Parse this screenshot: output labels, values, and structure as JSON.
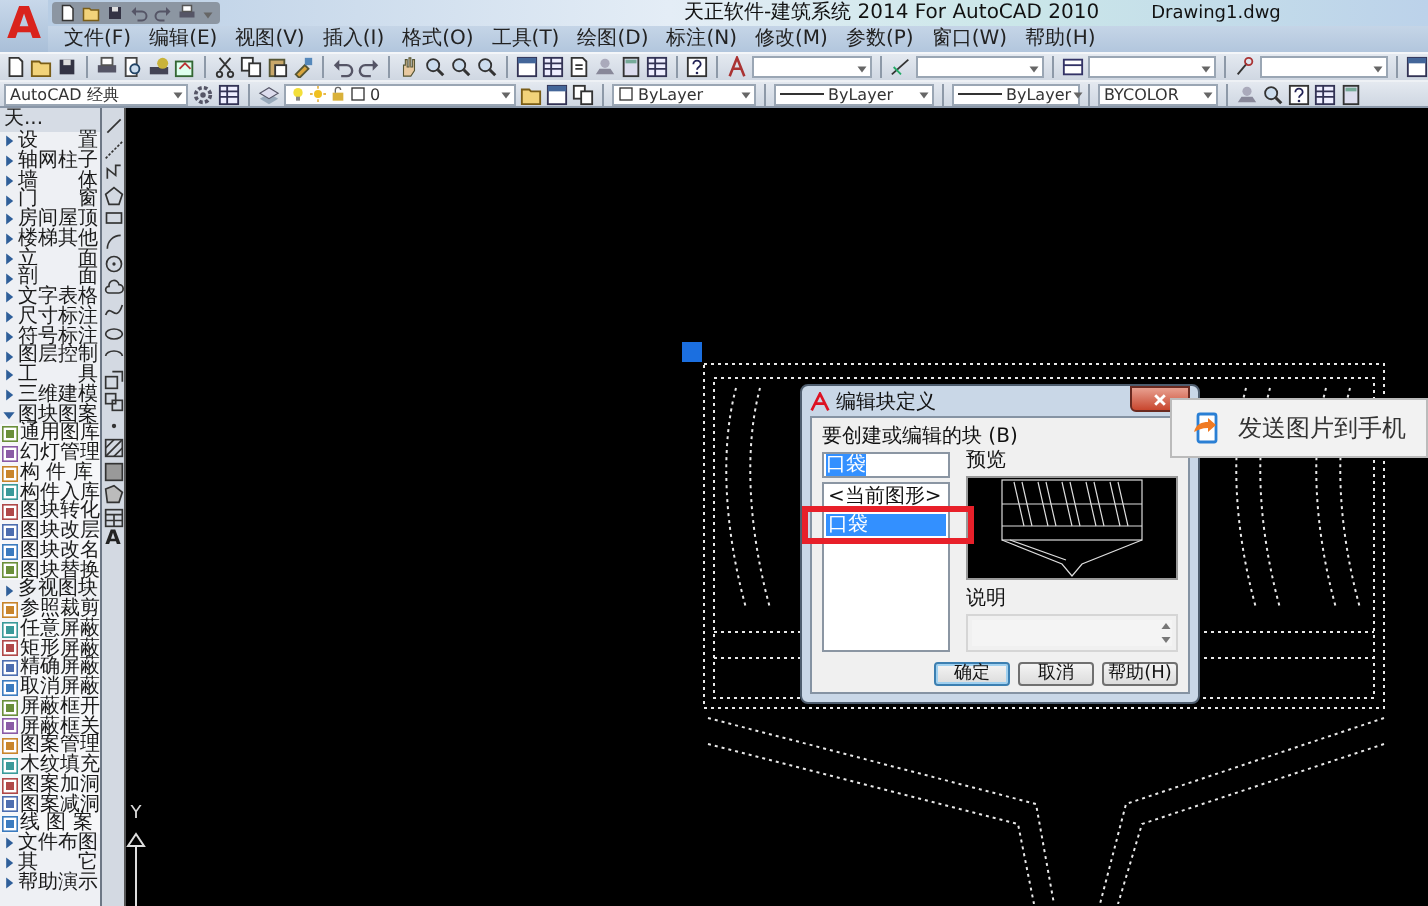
{
  "app_logo": {
    "letter": "A"
  },
  "title_bar": {
    "title": "天正软件-建筑系统 2014  For AutoCAD 2010",
    "document": "Drawing1.dwg"
  },
  "menu": [
    "文件(F)",
    "编辑(E)",
    "视图(V)",
    "插入(I)",
    "格式(O)",
    "工具(T)",
    "绘图(D)",
    "标注(N)",
    "修改(M)",
    "参数(P)",
    "窗口(W)",
    "帮助(H)"
  ],
  "properties_bar": {
    "workspace": "AutoCAD 经典",
    "layer": "0",
    "color_setting": "ByLayer",
    "linetype": "ByLayer",
    "lineweight": "ByLayer",
    "plot_style": "BYCOLOR"
  },
  "side_panel": {
    "title": "天...",
    "items": [
      {
        "label": "设　　置",
        "kind": "menu",
        "expanded": false
      },
      {
        "label": "轴网柱子",
        "kind": "menu",
        "expanded": false
      },
      {
        "label": "墙　　体",
        "kind": "menu",
        "expanded": false
      },
      {
        "label": "门　　窗",
        "kind": "menu",
        "expanded": false
      },
      {
        "label": "房间屋顶",
        "kind": "menu",
        "expanded": false
      },
      {
        "label": "楼梯其他",
        "kind": "menu",
        "expanded": false
      },
      {
        "label": "立　　面",
        "kind": "menu",
        "expanded": false
      },
      {
        "label": "剖　　面",
        "kind": "menu",
        "expanded": false
      },
      {
        "label": "文字表格",
        "kind": "menu",
        "expanded": false
      },
      {
        "label": "尺寸标注",
        "kind": "menu",
        "expanded": false
      },
      {
        "label": "符号标注",
        "kind": "menu",
        "expanded": false
      },
      {
        "label": "图层控制",
        "kind": "menu",
        "expanded": false
      },
      {
        "label": "工　　具",
        "kind": "menu",
        "expanded": false
      },
      {
        "label": "三维建模",
        "kind": "menu",
        "expanded": false
      },
      {
        "label": "图块图案",
        "kind": "menu",
        "expanded": true
      },
      {
        "label": "通用图库",
        "kind": "tool"
      },
      {
        "label": "幻灯管理",
        "kind": "tool"
      },
      {
        "label": "构 件 库",
        "kind": "tool"
      },
      {
        "label": "构件入库",
        "kind": "tool"
      },
      {
        "label": "图块转化",
        "kind": "tool"
      },
      {
        "label": "图块改层",
        "kind": "tool"
      },
      {
        "label": "图块改名",
        "kind": "tool"
      },
      {
        "label": "图块替换",
        "kind": "tool"
      },
      {
        "label": "多视图块",
        "kind": "menu",
        "expanded": false
      },
      {
        "label": "参照裁剪",
        "kind": "tool"
      },
      {
        "label": "任意屏蔽",
        "kind": "tool"
      },
      {
        "label": "矩形屏蔽",
        "kind": "tool"
      },
      {
        "label": "精确屏蔽",
        "kind": "tool"
      },
      {
        "label": "取消屏蔽",
        "kind": "tool"
      },
      {
        "label": "屏蔽框开",
        "kind": "tool"
      },
      {
        "label": "屏蔽框关",
        "kind": "tool"
      },
      {
        "label": "图案管理",
        "kind": "tool"
      },
      {
        "label": "木纹填充",
        "kind": "tool"
      },
      {
        "label": "图案加洞",
        "kind": "tool"
      },
      {
        "label": "图案减洞",
        "kind": "tool"
      },
      {
        "label": "线 图 案",
        "kind": "tool"
      },
      {
        "label": "文件布图",
        "kind": "menu",
        "expanded": false
      },
      {
        "label": "其　　它",
        "kind": "menu",
        "expanded": false
      },
      {
        "label": "帮助演示",
        "kind": "menu",
        "expanded": false
      }
    ]
  },
  "draw_toolbar": {
    "text_tool": "A"
  },
  "ucs": {
    "axis": "Y"
  },
  "dialog": {
    "title": "编辑块定义",
    "block_label": "要创建或编辑的块 (B)",
    "block_name": "口袋",
    "blocks": [
      {
        "label": "<当前图形>",
        "selected": false,
        "highlighted": false
      },
      {
        "label": "口袋",
        "selected": true,
        "highlighted": true
      }
    ],
    "preview_label": "预览",
    "description_label": "说明",
    "buttons": [
      {
        "label": "确定",
        "default": true
      },
      {
        "label": "取消",
        "default": false
      },
      {
        "label": "帮助(H)",
        "default": false
      }
    ]
  },
  "popup": {
    "label": "发送图片到手机"
  }
}
